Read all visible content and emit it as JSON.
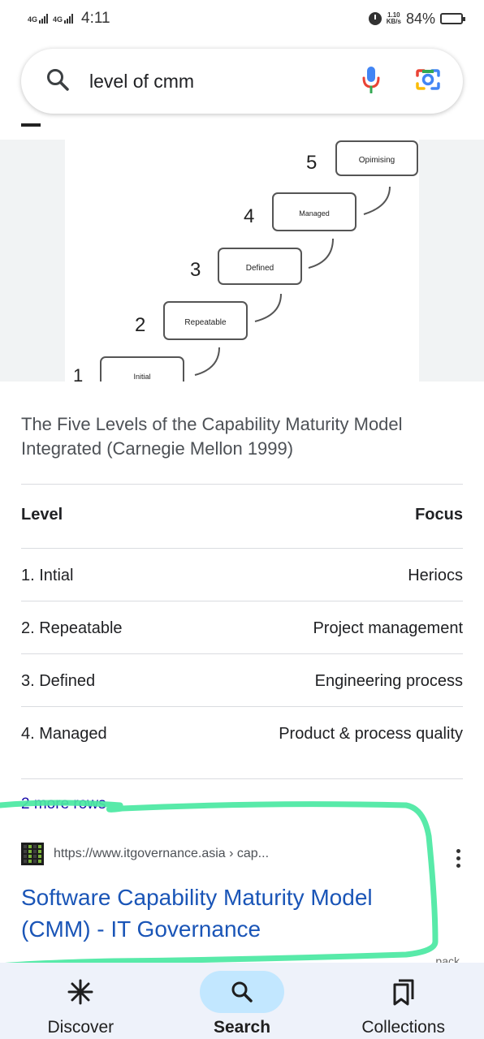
{
  "status_bar": {
    "network_1": "4G",
    "network_2": "4G",
    "time": "4:11",
    "speed_value": "1.10",
    "speed_unit": "KB/s",
    "battery": "84%"
  },
  "search": {
    "query": "level of cmm",
    "icons": [
      "search-icon",
      "mic-icon",
      "lens-camera-icon"
    ]
  },
  "figure": {
    "steps": [
      {
        "number": "1",
        "label": "Initial"
      },
      {
        "number": "2",
        "label": "Repeatable"
      },
      {
        "number": "3",
        "label": "Defined"
      },
      {
        "number": "4",
        "label": "Managed"
      },
      {
        "number": "5",
        "label": "Opimising"
      }
    ]
  },
  "caption": "The Five Levels of the Capability Maturity Model Integrated (Carnegie Mellon 1999)",
  "table": {
    "headers": {
      "level": "Level",
      "focus": "Focus"
    },
    "rows": [
      {
        "level": "1. Intial",
        "focus": "Heriocs"
      },
      {
        "level": "2. Repeatable",
        "focus": "Project management"
      },
      {
        "level": "3. Defined",
        "focus": "Engineering process"
      },
      {
        "level": "4. Managed",
        "focus": "Product & process quality"
      }
    ],
    "more_rows": "2 more rows"
  },
  "result": {
    "url": "https://www.itgovernance.asia › cap...",
    "title": "Software Capability Maturity Model (CMM) - IT Governance"
  },
  "highlight_color": "#4ae8a2",
  "bottom_nav": {
    "peek_text": "pack",
    "items": [
      {
        "label": "Discover",
        "icon": "asterisk-icon"
      },
      {
        "label": "Search",
        "icon": "search-icon",
        "active": true
      },
      {
        "label": "Collections",
        "icon": "bookmarks-icon"
      }
    ]
  },
  "colors": {
    "link": "#1a55b7",
    "active_nav_bg": "#c2e7ff",
    "nav_bg": "#eef2fa"
  }
}
